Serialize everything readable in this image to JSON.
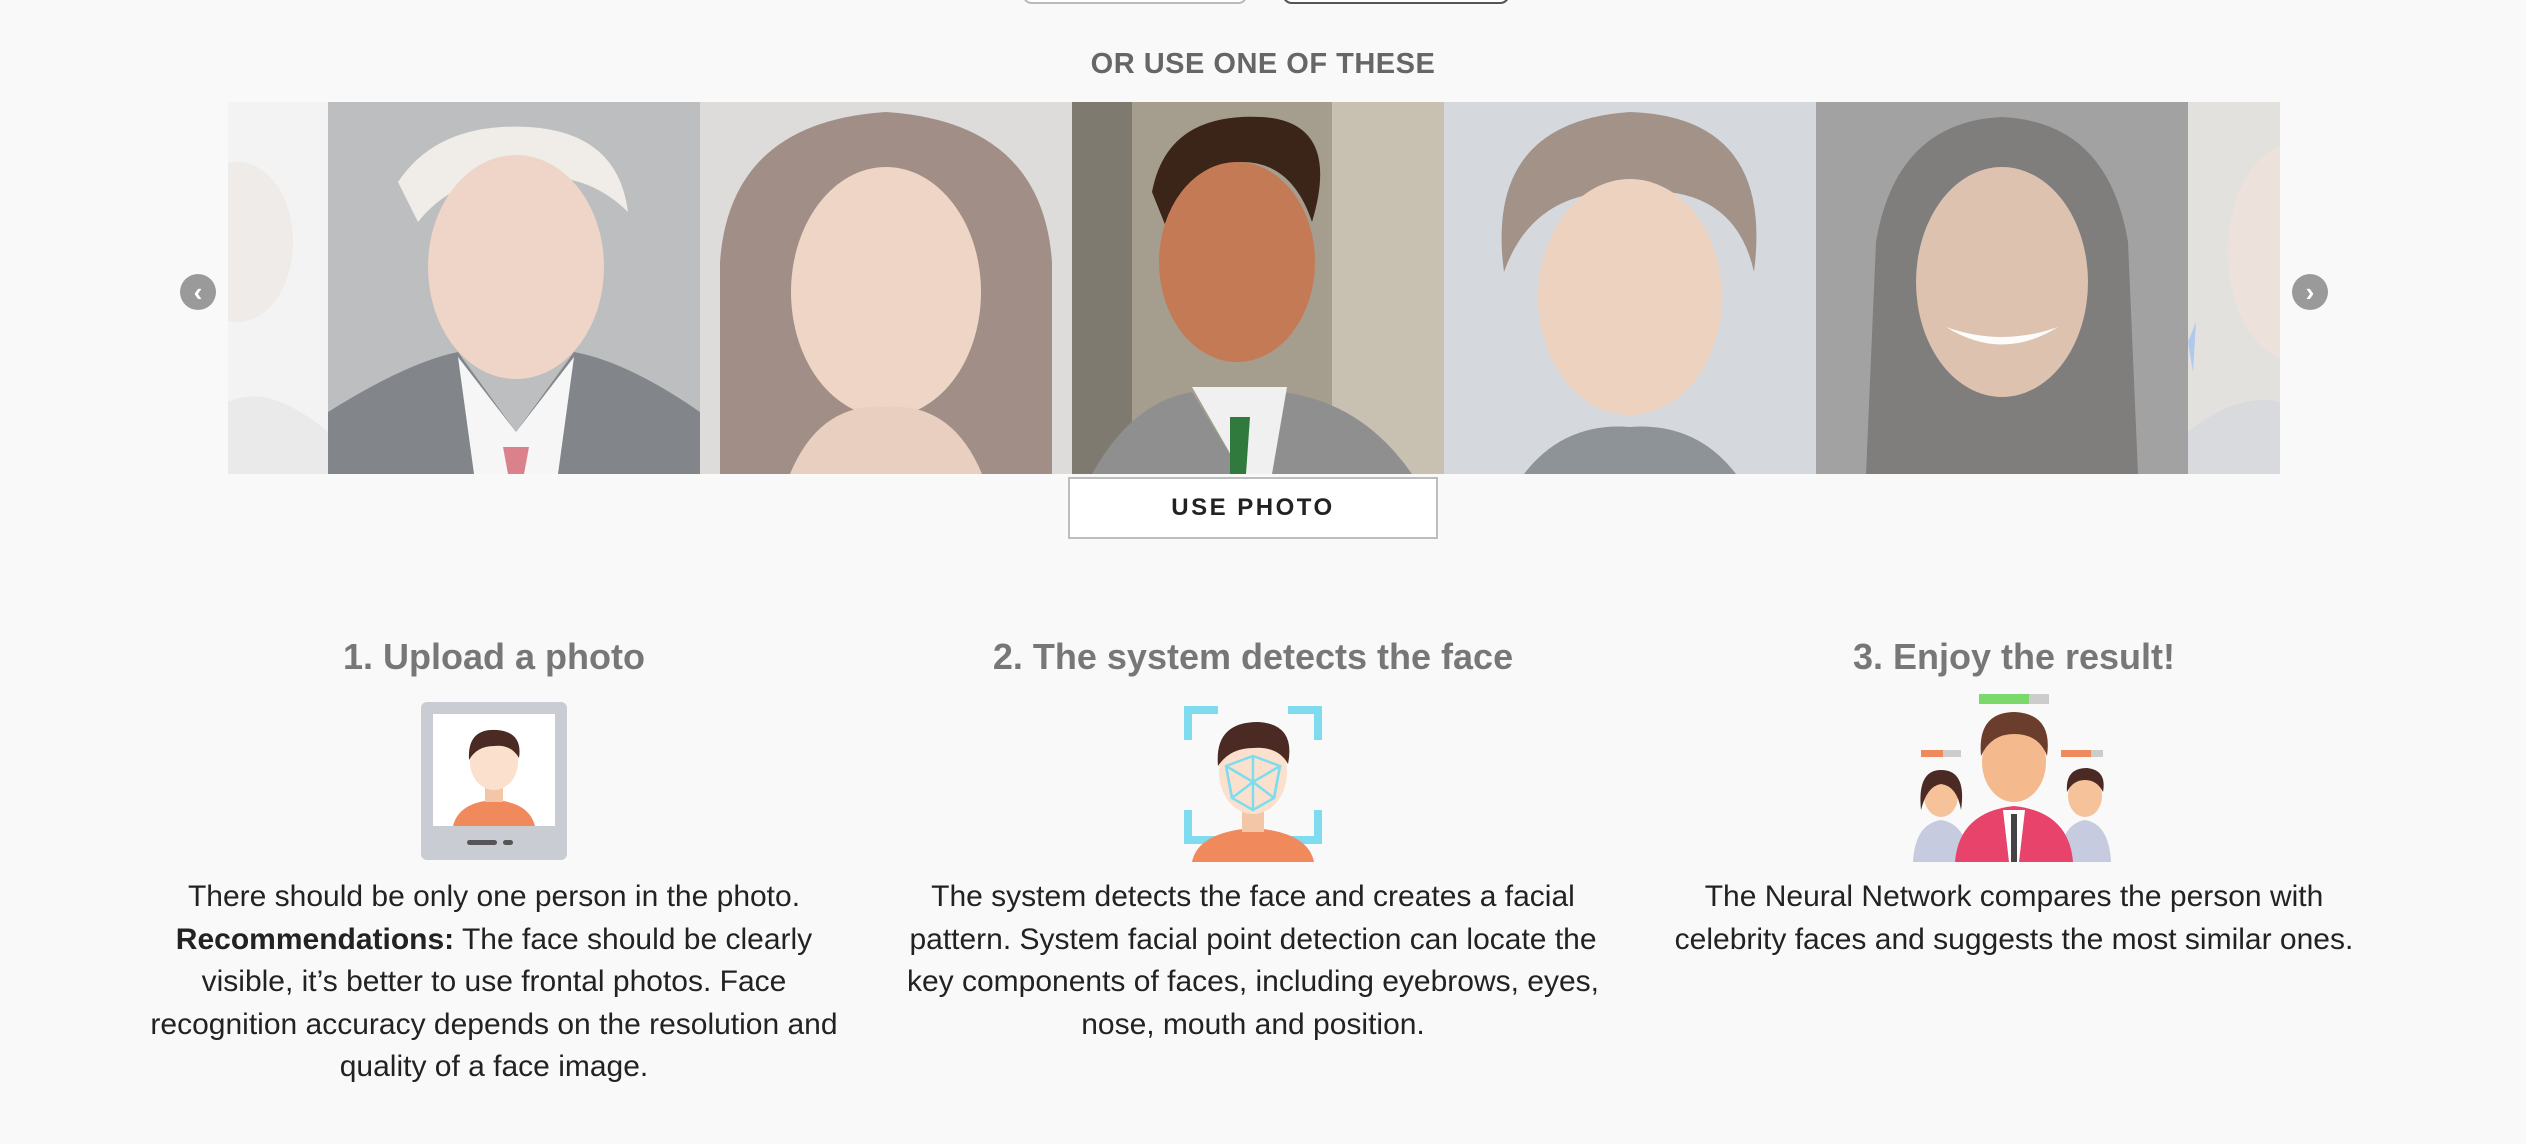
{
  "gallery": {
    "heading": "OR USE ONE OF THESE",
    "prev_icon": "chevron-left-icon",
    "next_icon": "chevron-right-icon",
    "photos": [
      {
        "name": "celebrity-photo-1",
        "state": "faded"
      },
      {
        "name": "celebrity-photo-2",
        "state": "dimmed"
      },
      {
        "name": "celebrity-photo-3",
        "state": "dimmed"
      },
      {
        "name": "celebrity-photo-4",
        "state": "selected"
      },
      {
        "name": "celebrity-photo-5",
        "state": "dimmed"
      },
      {
        "name": "celebrity-photo-6",
        "state": "dimmed"
      },
      {
        "name": "celebrity-photo-7",
        "state": "faded"
      }
    ],
    "use_photo_label": "USE PHOTO"
  },
  "steps": [
    {
      "title": "1. Upload a photo",
      "icon": "photo-upload-icon",
      "lead": "There should be only one person in the photo.",
      "bold": "Recommendations:",
      "text": " The face should be clearly visible, it’s better to use frontal photos. Face recognition accuracy depends on the resolution and quality of a face image."
    },
    {
      "title": "2. The system detects the face",
      "icon": "face-detection-icon",
      "text": "The system detects the face and creates a facial pattern. System facial point detection can locate the key components of faces, including eyebrows, eyes, nose, mouth and position."
    },
    {
      "title": "3. Enjoy the result!",
      "icon": "people-comparison-icon",
      "text": "The Neural Network compares the person with celebrity faces and suggests the most similar ones."
    }
  ],
  "colors": {
    "background": "#f9f9f9",
    "heading_gray": "#777777",
    "body_text": "#222222",
    "arrow_gray": "#9a9a9a",
    "accent_cyan": "#7fdcef",
    "accent_orange": "#f08a5d",
    "accent_pink": "#e8436a",
    "accent_green": "#7bd96b"
  }
}
